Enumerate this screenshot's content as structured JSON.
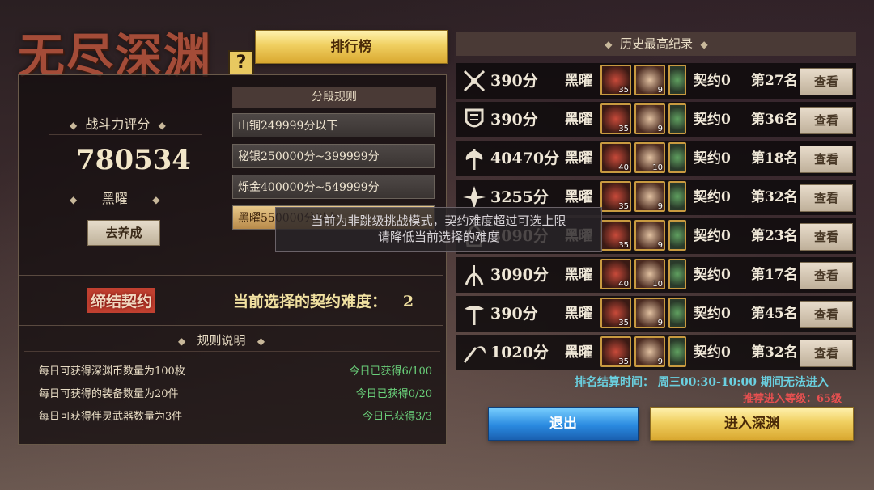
{
  "title": "无尽深渊",
  "help_icon": "question-icon",
  "ranking_button": "排行榜",
  "left": {
    "score_label": "战斗力评分",
    "score": "780534",
    "rank": "黑曜",
    "train_button": "去养成",
    "segment_header": "分段规则",
    "segments": [
      "山铜249999分以下",
      "秘银250000分~399999分",
      "烁金400000分~549999分",
      "黑曜550000分以上"
    ],
    "contract_button": "缔结契约",
    "contract_difficulty_label": "当前选择的契约难度：",
    "contract_difficulty": "2",
    "rules_header": "规则说明",
    "rules": [
      {
        "text": "每日可获得深渊币数量为100枚",
        "value": "今日已获得6/100"
      },
      {
        "text": "每日可获得的装备数量为20件",
        "value": "今日已获得0/20"
      },
      {
        "text": "每日可获得伴灵武器数量为3件",
        "value": "今日已获得3/3"
      }
    ]
  },
  "history": {
    "header": "历史最高纪录",
    "rows": [
      {
        "emblem": "crossed-swords-icon",
        "score": "390分",
        "rank": "黑曜",
        "items": [
          "35",
          "9",
          ""
        ],
        "contract": "契约0",
        "place": "第27名",
        "view": "查看"
      },
      {
        "emblem": "shield-icon",
        "score": "390分",
        "rank": "黑曜",
        "items": [
          "35",
          "9",
          ""
        ],
        "contract": "契约0",
        "place": "第36名",
        "view": "查看"
      },
      {
        "emblem": "axe-icon",
        "score": "40470分",
        "rank": "黑曜",
        "items": [
          "40",
          "10",
          ""
        ],
        "contract": "契约0",
        "place": "第18名",
        "view": "查看"
      },
      {
        "emblem": "spike-icon",
        "score": "3255分",
        "rank": "黑曜",
        "items": [
          "35",
          "9",
          ""
        ],
        "contract": "契约0",
        "place": "第32名",
        "view": "查看"
      },
      {
        "emblem": "hood-icon",
        "score": "3090分",
        "rank": "黑曜",
        "items": [
          "35",
          "9",
          ""
        ],
        "contract": "契约0",
        "place": "第23名",
        "view": "查看"
      },
      {
        "emblem": "bow-icon",
        "score": "3090分",
        "rank": "黑曜",
        "items": [
          "40",
          "10",
          ""
        ],
        "contract": "契约0",
        "place": "第17名",
        "view": "查看"
      },
      {
        "emblem": "staff-icon",
        "score": "390分",
        "rank": "黑曜",
        "items": [
          "35",
          "9",
          ""
        ],
        "contract": "契约0",
        "place": "第45名",
        "view": "查看"
      },
      {
        "emblem": "scythe-icon",
        "score": "1020分",
        "rank": "黑曜",
        "items": [
          "35",
          "9",
          ""
        ],
        "contract": "契约0",
        "place": "第32名",
        "view": "查看"
      }
    ]
  },
  "settle_time": "排名结算时间：  周三00:30-10:00  期间无法进入",
  "recommend_level": "推荐进入等级：65级",
  "exit_button": "退出",
  "enter_button": "进入深渊",
  "toast": {
    "line1": "当前为非跳级挑战模式，契约难度超过可选上限",
    "line2": "请降低当前选择的难度"
  },
  "colors": {
    "title": "#a44c38",
    "gold": "#f0cf60",
    "green": "#6ad07a",
    "cyan": "#6ad0e0",
    "red": "#e85050",
    "blue": "#2a8ae0"
  }
}
